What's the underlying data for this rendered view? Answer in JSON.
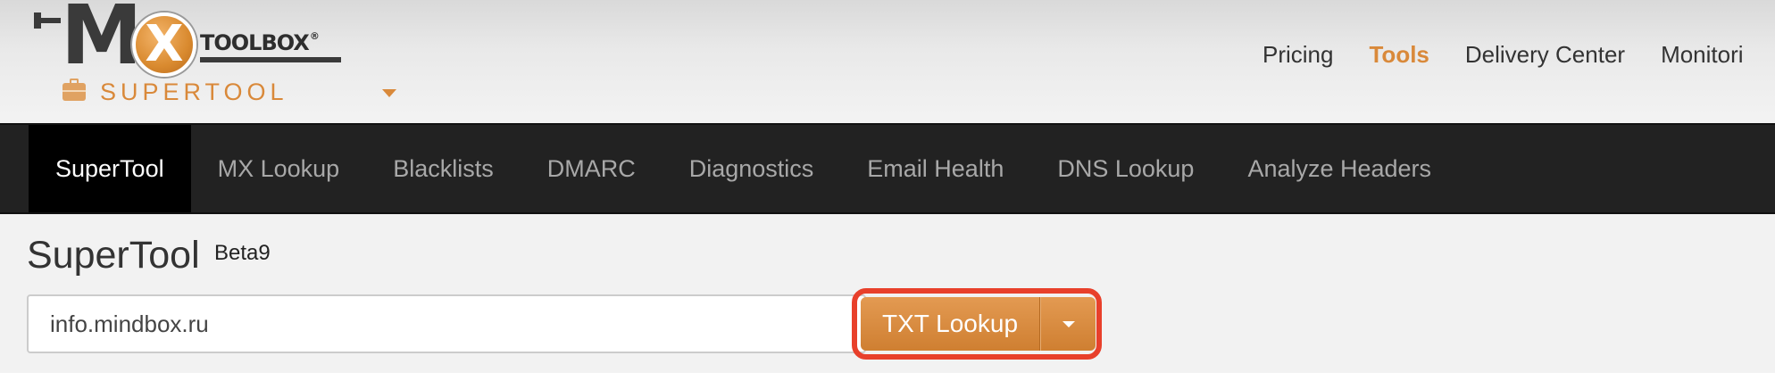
{
  "header": {
    "logo": {
      "m_letter": "M",
      "x_letter": "X",
      "wordmark": "TOOLBOX",
      "registered": "®"
    },
    "brand_label": "SUPERTOOL",
    "brand_icon": "toolbox-icon",
    "top_nav": [
      {
        "label": "Pricing",
        "active": false
      },
      {
        "label": "Tools",
        "active": true
      },
      {
        "label": "Delivery Center",
        "active": false
      },
      {
        "label": "Monitori",
        "active": false
      }
    ]
  },
  "navbar": {
    "items": [
      {
        "label": "SuperTool",
        "active": true
      },
      {
        "label": "MX Lookup",
        "active": false
      },
      {
        "label": "Blacklists",
        "active": false
      },
      {
        "label": "DMARC",
        "active": false
      },
      {
        "label": "Diagnostics",
        "active": false
      },
      {
        "label": "Email Health",
        "active": false
      },
      {
        "label": "DNS Lookup",
        "active": false
      },
      {
        "label": "Analyze Headers",
        "active": false
      }
    ]
  },
  "main": {
    "title": "SuperTool",
    "title_badge": "Beta9",
    "search": {
      "value": "info.mindbox.ru"
    },
    "lookup_button": "TXT Lookup",
    "dropdown_icon": "caret-down-icon"
  },
  "colors": {
    "accent": "#d9893a",
    "navbar_bg": "#222222",
    "highlight": "#e8402b"
  }
}
